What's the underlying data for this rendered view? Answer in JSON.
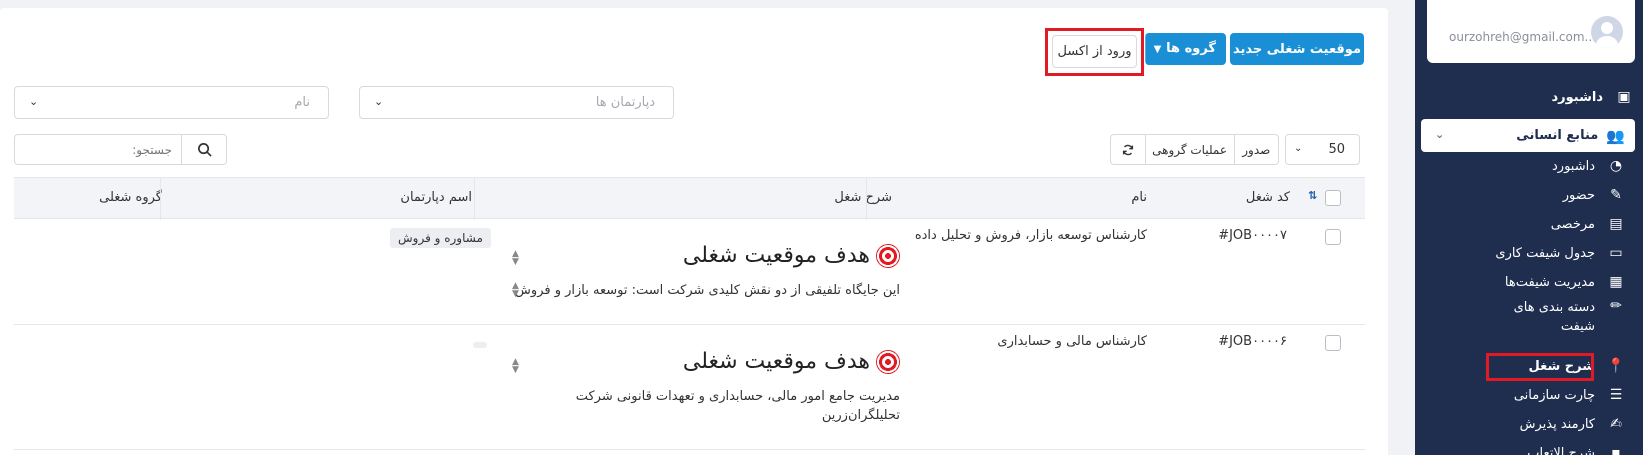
{
  "sidebar": {
    "user_email": "ourzohreh@gmail.com...",
    "dashboard_label": "داشبورد",
    "hr_label": "منابع انسانی",
    "items": [
      {
        "label": "داشبورد",
        "icon": "gauge-icon"
      },
      {
        "label": "حضور",
        "icon": "edit-icon"
      },
      {
        "label": "مرخصی",
        "icon": "clipboard-icon"
      },
      {
        "label": "جدول شیفت کاری",
        "icon": "ticket-icon"
      },
      {
        "label": "مدیریت شیفت‌ها",
        "icon": "calendar-icon"
      },
      {
        "label": "دسته بندی های شیفت",
        "icon": "pencil-icon"
      },
      {
        "label": "شرح شغل",
        "icon": "pin-icon"
      },
      {
        "label": "چارت سازمانی",
        "icon": "table-icon"
      },
      {
        "label": "کارمند پذیرش",
        "icon": "edit-square-icon"
      },
      {
        "label": "شرح الاتعاب...",
        "icon": "box-icon"
      }
    ]
  },
  "toolbar": {
    "new_position": "موقعیت شغلی جدید",
    "groups": "گروه ها",
    "import_excel": "ورود از اکسل"
  },
  "filters": {
    "department_placeholder": "دپارتمان ها",
    "name_placeholder": "نام"
  },
  "list_controls": {
    "page_size": "50",
    "export": "صدور",
    "bulk_actions": "عملیات گروهی",
    "search_placeholder": "جستجو:"
  },
  "table": {
    "columns": {
      "code": "کد شغل",
      "name": "نام",
      "description": "شرح شغل",
      "department": "اسم دپارتمان",
      "group": "گروه شغلی"
    },
    "rows": [
      {
        "code": "#JOB۰۰۰۰۷",
        "name": "کارشناس توسعه بازار، فروش و تحلیل داده",
        "desc_heading": "هدف موقعیت شغلی",
        "desc_text": "این جایگاه تلفیقی از دو نقش کلیدی شرکت است: توسعه بازار و فروش",
        "department": "مشاوره و فروش",
        "group": ""
      },
      {
        "code": "#JOB۰۰۰۰۶",
        "name": "کارشناس مالی و حسابداری",
        "desc_heading": "هدف موقعیت شغلی",
        "desc_text_line1": "مدیریت جامع امور مالی، حسابداری و تعهدات قانونی شرکت",
        "desc_text_line2": "تحلیلگران‌زرین",
        "department": "",
        "group": ""
      }
    ]
  }
}
